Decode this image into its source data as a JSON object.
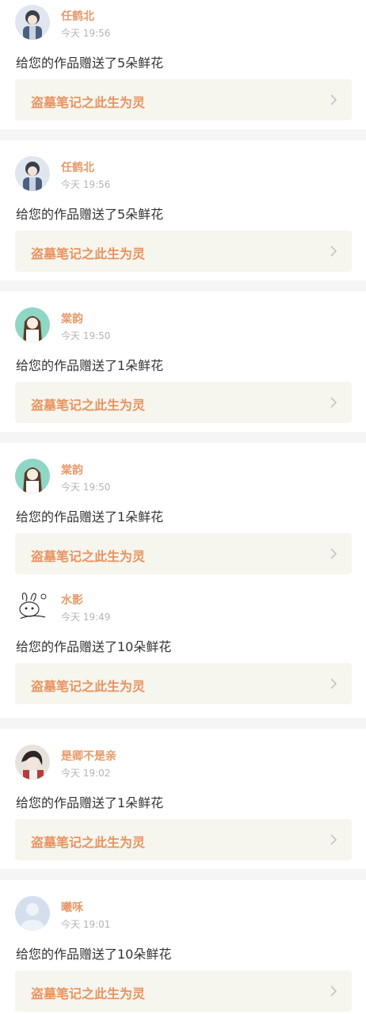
{
  "colors": {
    "username": "#e89a6a",
    "work_title": "#e8935f",
    "link_background": "#f6f5ee",
    "timestamp": "#b4b4b4",
    "message": "#333333",
    "divider": "#f5f5f5"
  },
  "notifications": [
    {
      "user": "任鹤北",
      "time": "今天 19:56",
      "message": "给您的作品赠送了5朵鲜花",
      "work": "盗墓笔记之此生为灵",
      "avatar_icon": "anime-boy-avatar-icon"
    },
    {
      "user": "任鹤北",
      "time": "今天 19:56",
      "message": "给您的作品赠送了5朵鲜花",
      "work": "盗墓笔记之此生为灵",
      "avatar_icon": "anime-boy-avatar-icon"
    },
    {
      "user": "棠韵",
      "time": "今天 19:50",
      "message": "给您的作品赠送了1朵鲜花",
      "work": "盗墓笔记之此生为灵",
      "avatar_icon": "anime-girl-avatar-icon"
    },
    {
      "user": "棠韵",
      "time": "今天 19:50",
      "message": "给您的作品赠送了1朵鲜花",
      "work": "盗墓笔记之此生为灵",
      "avatar_icon": "anime-girl-avatar-icon"
    },
    {
      "user": "水影",
      "time": "今天 19:49",
      "message": "给您的作品赠送了10朵鲜花",
      "work": "盗墓笔记之此生为灵",
      "avatar_icon": "doodle-rabbit-avatar-icon"
    },
    {
      "user": "是卿不是亲",
      "time": "今天 19:02",
      "message": "给您的作品赠送了1朵鲜花",
      "work": "盗墓笔记之此生为灵",
      "avatar_icon": "anime-character-avatar-icon"
    },
    {
      "user": "曦咊",
      "time": "今天 19:01",
      "message": "给您的作品赠送了10朵鲜花",
      "work": "盗墓笔记之此生为灵",
      "avatar_icon": "default-user-avatar-icon"
    }
  ]
}
